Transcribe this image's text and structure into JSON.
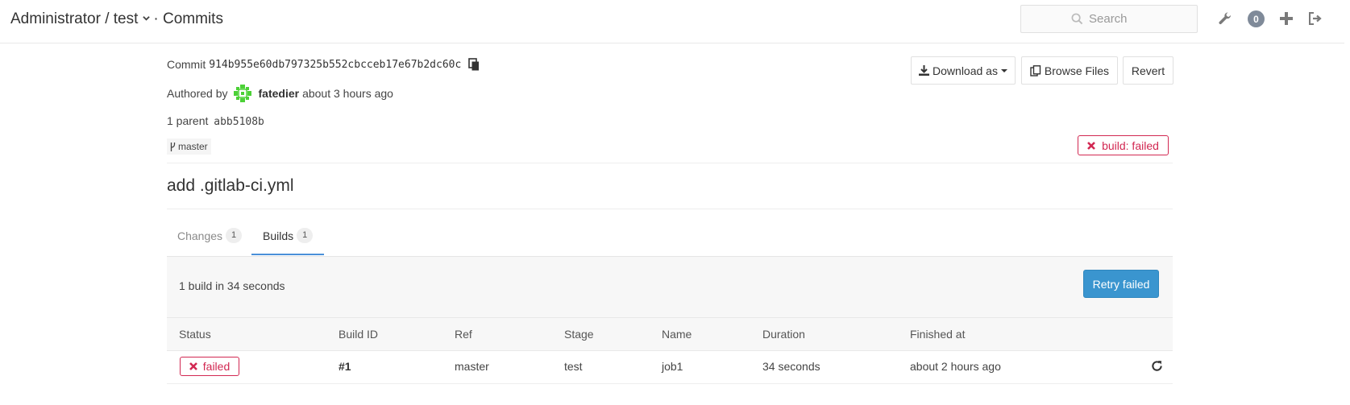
{
  "header": {
    "breadcrumb_path": "Administrator / test",
    "breadcrumb_separator": "·",
    "breadcrumb_page": "Commits",
    "search_placeholder": "Search",
    "todo_count": "0",
    "icons": [
      "wrench-icon",
      "plus-icon",
      "sign-out-icon",
      "search-icon"
    ]
  },
  "commit": {
    "label": "Commit",
    "sha": "914b955e60db797325b552cbcceb17e67b2dc60c",
    "authored_label": "Authored by",
    "author": "fatedier",
    "time_ago": "about 3 hours ago",
    "parent_label": "1 parent",
    "parent_sha": "abb5108b",
    "branch": "master",
    "build_status": "build: failed",
    "message": "add .gitlab-ci.yml"
  },
  "actions": {
    "download": "Download as",
    "browse": "Browse Files",
    "revert": "Revert"
  },
  "tabs": [
    {
      "label": "Changes",
      "count": "1"
    },
    {
      "label": "Builds",
      "count": "1"
    }
  ],
  "builds": {
    "summary": "1 build in 34 seconds",
    "retry_label": "Retry failed",
    "columns": [
      "Status",
      "Build ID",
      "Ref",
      "Stage",
      "Name",
      "Duration",
      "Finished at"
    ],
    "rows": [
      {
        "status": "failed",
        "id": "#1",
        "ref": "master",
        "stage": "test",
        "name": "job1",
        "duration": "34 seconds",
        "finished": "about 2 hours ago"
      }
    ]
  },
  "colors": {
    "failed": "#d22852",
    "primary": "#3a95cf",
    "avatar": "#4cd137"
  }
}
